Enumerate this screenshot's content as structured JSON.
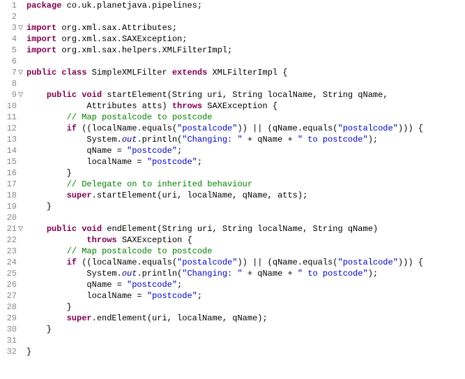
{
  "lines": [
    {
      "num": "1",
      "marker": "",
      "tokens": [
        {
          "c": "kw",
          "t": "package"
        },
        {
          "c": "pln",
          "t": " co.uk.planetjava.pipelines;"
        }
      ]
    },
    {
      "num": "2",
      "marker": "",
      "tokens": [
        {
          "c": "pln",
          "t": ""
        }
      ]
    },
    {
      "num": "3",
      "marker": "▽",
      "tokens": [
        {
          "c": "kw",
          "t": "import"
        },
        {
          "c": "pln",
          "t": " org.xml.sax.Attributes;"
        }
      ]
    },
    {
      "num": "4",
      "marker": "",
      "tokens": [
        {
          "c": "kw",
          "t": "import"
        },
        {
          "c": "pln",
          "t": " org.xml.sax.SAXException;"
        }
      ]
    },
    {
      "num": "5",
      "marker": "",
      "tokens": [
        {
          "c": "kw",
          "t": "import"
        },
        {
          "c": "pln",
          "t": " org.xml.sax.helpers.XMLFilterImpl;"
        }
      ]
    },
    {
      "num": "6",
      "marker": "",
      "tokens": [
        {
          "c": "pln",
          "t": ""
        }
      ]
    },
    {
      "num": "7",
      "marker": "▽",
      "tokens": [
        {
          "c": "kw",
          "t": "public"
        },
        {
          "c": "pln",
          "t": " "
        },
        {
          "c": "kw",
          "t": "class"
        },
        {
          "c": "pln",
          "t": " SimpleXMLFilter "
        },
        {
          "c": "kw",
          "t": "extends"
        },
        {
          "c": "pln",
          "t": " XMLFilterImpl {"
        }
      ]
    },
    {
      "num": "8",
      "marker": "",
      "tokens": [
        {
          "c": "pln",
          "t": ""
        }
      ]
    },
    {
      "num": "9",
      "marker": "▽",
      "tokens": [
        {
          "c": "pln",
          "t": "    "
        },
        {
          "c": "kw",
          "t": "public"
        },
        {
          "c": "pln",
          "t": " "
        },
        {
          "c": "kw",
          "t": "void"
        },
        {
          "c": "pln",
          "t": " startElement(String uri, String localName, String qName,"
        }
      ]
    },
    {
      "num": "10",
      "marker": "",
      "tokens": [
        {
          "c": "pln",
          "t": "            Attributes atts) "
        },
        {
          "c": "kw",
          "t": "throws"
        },
        {
          "c": "pln",
          "t": " SAXException {"
        }
      ]
    },
    {
      "num": "11",
      "marker": "",
      "tokens": [
        {
          "c": "pln",
          "t": "        "
        },
        {
          "c": "com",
          "t": "// Map postalcode to postcode"
        }
      ]
    },
    {
      "num": "12",
      "marker": "",
      "tokens": [
        {
          "c": "pln",
          "t": "        "
        },
        {
          "c": "kw",
          "t": "if"
        },
        {
          "c": "pln",
          "t": " ((localName.equals("
        },
        {
          "c": "str",
          "t": "\"postalcode\""
        },
        {
          "c": "pln",
          "t": ")) || (qName.equals("
        },
        {
          "c": "str",
          "t": "\"postalcode\""
        },
        {
          "c": "pln",
          "t": "))) {"
        }
      ]
    },
    {
      "num": "13",
      "marker": "",
      "tokens": [
        {
          "c": "pln",
          "t": "            System."
        },
        {
          "c": "fld",
          "t": "out"
        },
        {
          "c": "pln",
          "t": ".println("
        },
        {
          "c": "str",
          "t": "\"Changing: \""
        },
        {
          "c": "pln",
          "t": " + qName + "
        },
        {
          "c": "str",
          "t": "\" to postcode\""
        },
        {
          "c": "pln",
          "t": ");"
        }
      ]
    },
    {
      "num": "14",
      "marker": "",
      "tokens": [
        {
          "c": "pln",
          "t": "            qName = "
        },
        {
          "c": "str",
          "t": "\"postcode\""
        },
        {
          "c": "pln",
          "t": ";"
        }
      ]
    },
    {
      "num": "15",
      "marker": "",
      "tokens": [
        {
          "c": "pln",
          "t": "            localName = "
        },
        {
          "c": "str",
          "t": "\"postcode\""
        },
        {
          "c": "pln",
          "t": ";"
        }
      ]
    },
    {
      "num": "16",
      "marker": "",
      "tokens": [
        {
          "c": "pln",
          "t": "        }"
        }
      ]
    },
    {
      "num": "17",
      "marker": "",
      "tokens": [
        {
          "c": "pln",
          "t": "        "
        },
        {
          "c": "com",
          "t": "// Delegate on to inherited behaviour"
        }
      ]
    },
    {
      "num": "18",
      "marker": "",
      "tokens": [
        {
          "c": "pln",
          "t": "        "
        },
        {
          "c": "kw",
          "t": "super"
        },
        {
          "c": "pln",
          "t": ".startElement(uri, localName, qName, atts);"
        }
      ]
    },
    {
      "num": "19",
      "marker": "",
      "tokens": [
        {
          "c": "pln",
          "t": "    }"
        }
      ]
    },
    {
      "num": "20",
      "marker": "",
      "tokens": [
        {
          "c": "pln",
          "t": ""
        }
      ]
    },
    {
      "num": "21",
      "marker": "▽",
      "tokens": [
        {
          "c": "pln",
          "t": "    "
        },
        {
          "c": "kw",
          "t": "public"
        },
        {
          "c": "pln",
          "t": " "
        },
        {
          "c": "kw",
          "t": "void"
        },
        {
          "c": "pln",
          "t": " endElement(String uri, String localName, String qName)"
        }
      ]
    },
    {
      "num": "22",
      "marker": "",
      "tokens": [
        {
          "c": "pln",
          "t": "            "
        },
        {
          "c": "kw",
          "t": "throws"
        },
        {
          "c": "pln",
          "t": " SAXException {"
        }
      ]
    },
    {
      "num": "23",
      "marker": "",
      "tokens": [
        {
          "c": "pln",
          "t": "        "
        },
        {
          "c": "com",
          "t": "// Map postalcode to postcode"
        }
      ]
    },
    {
      "num": "24",
      "marker": "",
      "tokens": [
        {
          "c": "pln",
          "t": "        "
        },
        {
          "c": "kw",
          "t": "if"
        },
        {
          "c": "pln",
          "t": " ((localName.equals("
        },
        {
          "c": "str",
          "t": "\"postalcode\""
        },
        {
          "c": "pln",
          "t": ")) || (qName.equals("
        },
        {
          "c": "str",
          "t": "\"postalcode\""
        },
        {
          "c": "pln",
          "t": "))) {"
        }
      ]
    },
    {
      "num": "25",
      "marker": "",
      "tokens": [
        {
          "c": "pln",
          "t": "            System."
        },
        {
          "c": "fld",
          "t": "out"
        },
        {
          "c": "pln",
          "t": ".println("
        },
        {
          "c": "str",
          "t": "\"Changing: \""
        },
        {
          "c": "pln",
          "t": " + qName + "
        },
        {
          "c": "str",
          "t": "\" to postcode\""
        },
        {
          "c": "pln",
          "t": ");"
        }
      ]
    },
    {
      "num": "26",
      "marker": "",
      "tokens": [
        {
          "c": "pln",
          "t": "            qName = "
        },
        {
          "c": "str",
          "t": "\"postcode\""
        },
        {
          "c": "pln",
          "t": ";"
        }
      ]
    },
    {
      "num": "27",
      "marker": "",
      "tokens": [
        {
          "c": "pln",
          "t": "            localName = "
        },
        {
          "c": "str",
          "t": "\"postcode\""
        },
        {
          "c": "pln",
          "t": ";"
        }
      ]
    },
    {
      "num": "28",
      "marker": "",
      "tokens": [
        {
          "c": "pln",
          "t": "        }"
        }
      ]
    },
    {
      "num": "29",
      "marker": "",
      "tokens": [
        {
          "c": "pln",
          "t": "        "
        },
        {
          "c": "kw",
          "t": "super"
        },
        {
          "c": "pln",
          "t": ".endElement(uri, localName, qName);"
        }
      ]
    },
    {
      "num": "30",
      "marker": "",
      "tokens": [
        {
          "c": "pln",
          "t": "    }"
        }
      ]
    },
    {
      "num": "31",
      "marker": "",
      "tokens": [
        {
          "c": "pln",
          "t": ""
        }
      ]
    },
    {
      "num": "32",
      "marker": "",
      "tokens": [
        {
          "c": "pln",
          "t": "}"
        }
      ]
    }
  ]
}
